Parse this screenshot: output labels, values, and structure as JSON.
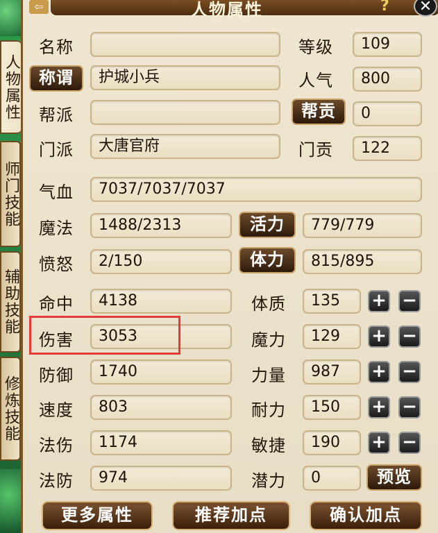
{
  "window": {
    "title": "人物属性",
    "help_icon": "?",
    "close_icon": "✕",
    "back_icon": "⇦"
  },
  "side_tabs": [
    "人物属性",
    "师门技能",
    "辅助技能",
    "修炼技能"
  ],
  "info": {
    "name_label": "名称",
    "name_value": "",
    "level_label": "等级",
    "level_value": "109",
    "title_button": "称谓",
    "title_value": "护城小兵",
    "popularity_label": "人气",
    "popularity_value": "800",
    "guild_label": "帮派",
    "guild_value": "",
    "guild_contrib_button": "帮贡",
    "guild_contrib_value": "0",
    "sect_label": "门派",
    "sect_value": "大唐官府",
    "sect_contrib_label": "门贡",
    "sect_contrib_value": "122"
  },
  "vitals": {
    "hp_label": "气血",
    "hp_value": "7037/7037/7037",
    "mp_label": "魔法",
    "mp_value": "1488/2313",
    "vitality_button": "活力",
    "vitality_value": "779/779",
    "rage_label": "愤怒",
    "rage_value": "2/150",
    "stamina_button": "体力",
    "stamina_value": "815/895"
  },
  "combat": [
    {
      "label": "命中",
      "value": "4138"
    },
    {
      "label": "伤害",
      "value": "3053"
    },
    {
      "label": "防御",
      "value": "1740"
    },
    {
      "label": "速度",
      "value": "803"
    },
    {
      "label": "法伤",
      "value": "1174"
    },
    {
      "label": "法防",
      "value": "974"
    }
  ],
  "attributes": [
    {
      "label": "体质",
      "value": "135"
    },
    {
      "label": "魔力",
      "value": "129"
    },
    {
      "label": "力量",
      "value": "987"
    },
    {
      "label": "耐力",
      "value": "150"
    },
    {
      "label": "敏捷",
      "value": "190"
    },
    {
      "label": "潜力",
      "value": "0"
    }
  ],
  "controls": {
    "plus": "+",
    "minus": "−",
    "preview_button": "预览"
  },
  "bottom": {
    "more_attributes": "更多属性",
    "recommend_points": "推荐加点",
    "confirm_points": "确认加点"
  },
  "colors": {
    "highlight": "#e53a3a",
    "panel_bg": "#ebe2cc",
    "button_dark": "#3a200b",
    "jade": "#2d9a4c"
  }
}
